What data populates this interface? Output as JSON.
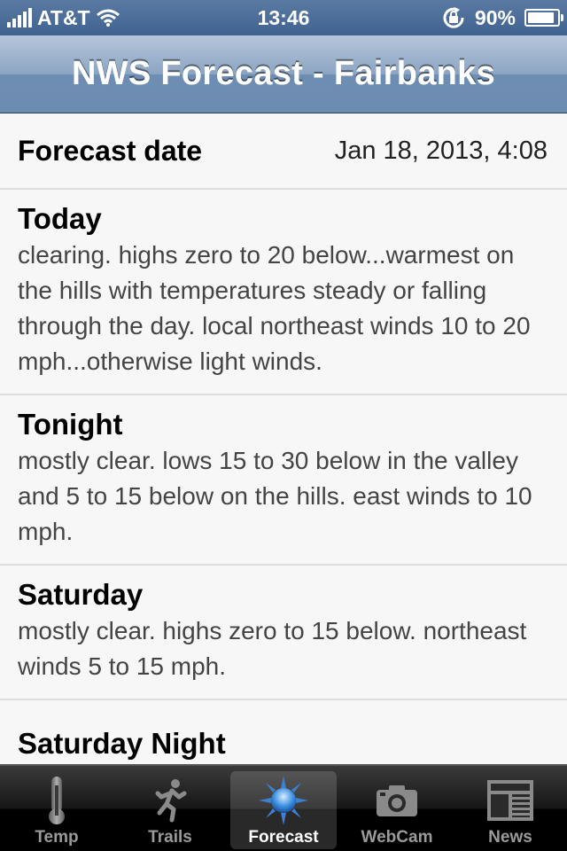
{
  "status_bar": {
    "carrier": "AT&T",
    "time": "13:46",
    "battery_percent": "90%",
    "battery_level": 0.9
  },
  "nav": {
    "title": "NWS Forecast - Fairbanks"
  },
  "forecast": {
    "date_label": "Forecast date",
    "date_value": "Jan 18, 2013, 4:08",
    "periods": [
      {
        "name": "Today",
        "text": "clearing. highs zero to 20 below...warmest on the hills with temperatures steady or falling through the day. local northeast winds 10 to 20 mph...otherwise light winds."
      },
      {
        "name": "Tonight",
        "text": "mostly clear. lows 15 to 30 below in the valley and 5 to 15 below on the hills. east winds to 10 mph."
      },
      {
        "name": "Saturday",
        "text": "mostly clear. highs zero to 15 below. northeast winds 5 to 15 mph."
      },
      {
        "name": "Saturday Night"
      }
    ]
  },
  "tabs": [
    {
      "label": "Temp",
      "icon": "thermometer-icon"
    },
    {
      "label": "Trails",
      "icon": "runner-icon"
    },
    {
      "label": "Forecast",
      "icon": "sun-icon",
      "selected": true
    },
    {
      "label": "WebCam",
      "icon": "camera-icon"
    },
    {
      "label": "News",
      "icon": "newspaper-icon"
    }
  ],
  "colors": {
    "status_bar": "#4a6b96",
    "nav_bar": "#7d98bb",
    "tab_bar": "#000000",
    "selected_tab_label": "#ffffff",
    "tab_label": "#9a9a9a"
  }
}
